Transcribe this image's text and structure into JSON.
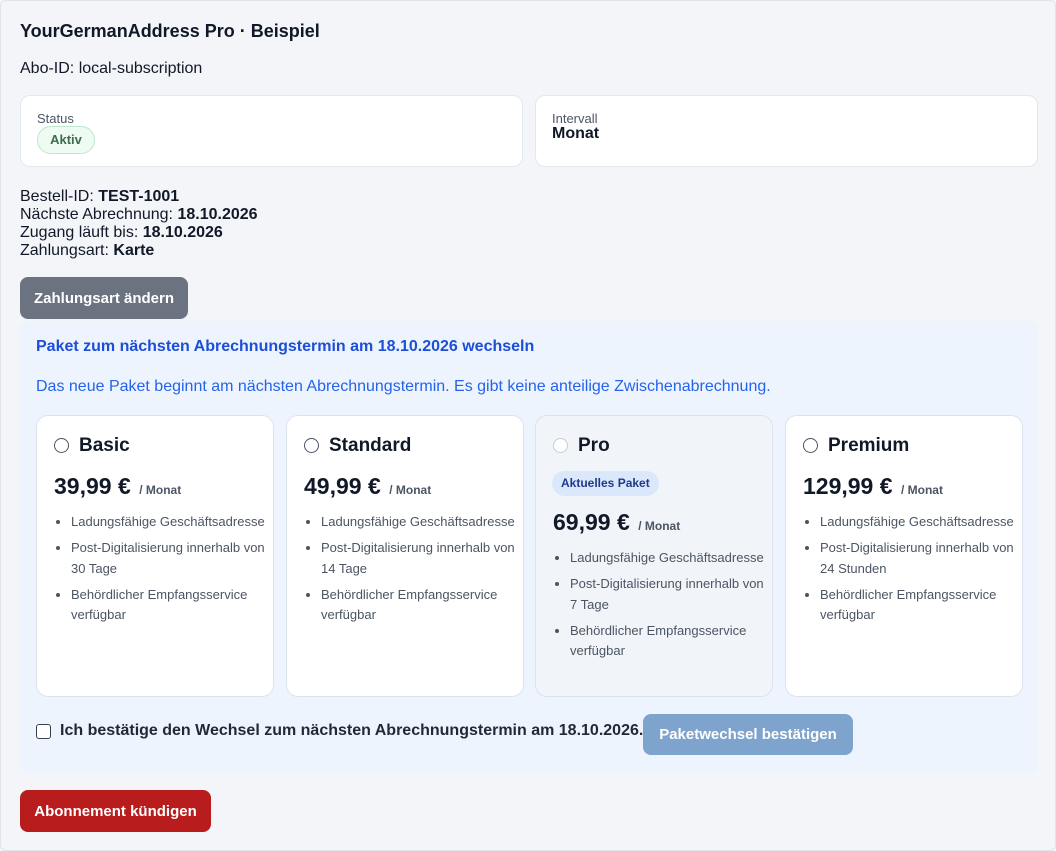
{
  "header": {
    "title": "YourGermanAddress Pro · Beispiel",
    "subscription_id_label": "Abo-ID:",
    "subscription_id": "local-subscription"
  },
  "status_card": {
    "label": "Status",
    "value": "Aktiv"
  },
  "interval_card": {
    "label": "Intervall",
    "value": "Monat"
  },
  "details": {
    "order_id_label": "Bestell-ID:",
    "order_id": "TEST-1001",
    "next_billing_label": "Nächste Abrechnung:",
    "next_billing": "18.10.2026",
    "access_until_label": "Zugang läuft bis:",
    "access_until": "18.10.2026",
    "payment_method_label": "Zahlungsart:",
    "payment_method": "Karte"
  },
  "change_payment_button": "Zahlungsart ändern",
  "plan_change": {
    "title": "Paket zum nächsten Abrechnungstermin am 18.10.2026 wechseln",
    "note": "Das neue Paket beginnt am nächsten Abrechnungstermin. Es gibt keine anteilige Zwischenabrechnung.",
    "plans": [
      {
        "name": "Basic",
        "price": "39,99 €",
        "period": "/ Monat",
        "current": false,
        "features": [
          "Ladungsfähige Geschäftsadresse",
          "Post-Digitalisierung innerhalb von 30 Tage",
          "Behördlicher Empfangsservice verfügbar"
        ]
      },
      {
        "name": "Standard",
        "price": "49,99 €",
        "period": "/ Monat",
        "current": false,
        "features": [
          "Ladungsfähige Geschäftsadresse",
          "Post-Digitalisierung innerhalb von 14 Tage",
          "Behördlicher Empfangsservice verfügbar"
        ]
      },
      {
        "name": "Pro",
        "price": "69,99 €",
        "period": "/ Monat",
        "current": true,
        "badge": "Aktuelles Paket",
        "features": [
          "Ladungsfähige Geschäftsadresse",
          "Post-Digitalisierung innerhalb von 7 Tage",
          "Behördlicher Empfangsservice verfügbar"
        ]
      },
      {
        "name": "Premium",
        "price": "129,99 €",
        "period": "/ Monat",
        "current": false,
        "features": [
          "Ladungsfähige Geschäftsadresse",
          "Post-Digitalisierung innerhalb von 24 Stunden",
          "Behördlicher Empfangsservice verfügbar"
        ]
      }
    ],
    "confirm_label": "Ich bestätige den Wechsel zum nächsten Abrechnungstermin am 18.10.2026.",
    "confirm_button": "Paketwechsel bestätigen"
  },
  "cancel_button": "Abonnement kündigen",
  "colors": {
    "primary_blue": "#1d4ed8",
    "confirm_button": "#7ea3cc",
    "cancel_button": "#b91c1c",
    "neutral_button": "#6b7280",
    "status_active_bg": "#eefbf2"
  }
}
